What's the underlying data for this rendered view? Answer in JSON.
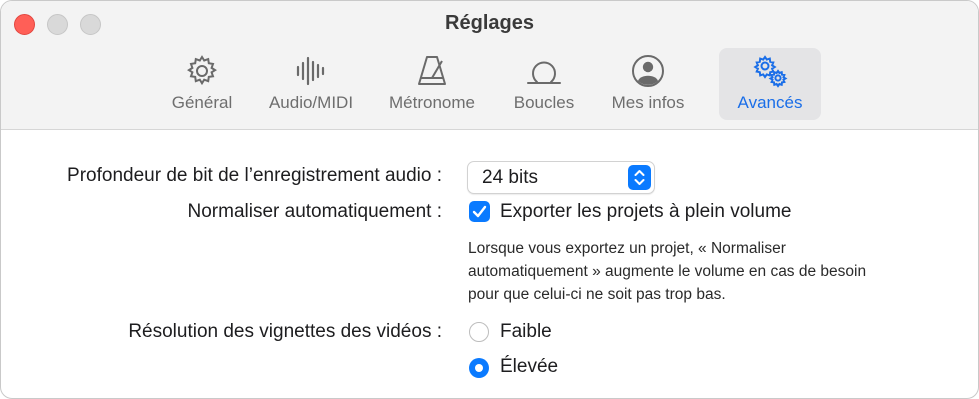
{
  "window": {
    "title": "Réglages"
  },
  "toolbar": {
    "items": [
      {
        "label": "Général",
        "icon": "gear-icon"
      },
      {
        "label": "Audio/MIDI",
        "icon": "waveform-icon"
      },
      {
        "label": "Métronome",
        "icon": "metronome-icon"
      },
      {
        "label": "Boucles",
        "icon": "loop-icon"
      },
      {
        "label": "Mes infos",
        "icon": "person-icon"
      },
      {
        "label": "Avancés",
        "icon": "gears-icon",
        "selected": true
      }
    ]
  },
  "settings": {
    "bit_depth": {
      "label": "Profondeur de bit de l’enregistrement audio :",
      "value": "24 bits"
    },
    "normalize": {
      "label": "Normaliser automatiquement :",
      "checkbox_label": "Exporter les projets à plein volume",
      "checked": true,
      "help_lines": [
        "Lorsque vous exportez un projet, « Normaliser",
        "automatiquement » augmente le volume en cas de besoin",
        "pour que celui-ci ne soit pas trop bas."
      ]
    },
    "thumbnail_resolution": {
      "label": "Résolution des vignettes des vidéos :",
      "options": [
        {
          "label": "Faible",
          "selected": false
        },
        {
          "label": "Élevée",
          "selected": true
        }
      ]
    }
  },
  "colors": {
    "accent": "#0a7aff",
    "close_button": "#ff5f57",
    "selected_tab_label": "#1a6ee8"
  }
}
